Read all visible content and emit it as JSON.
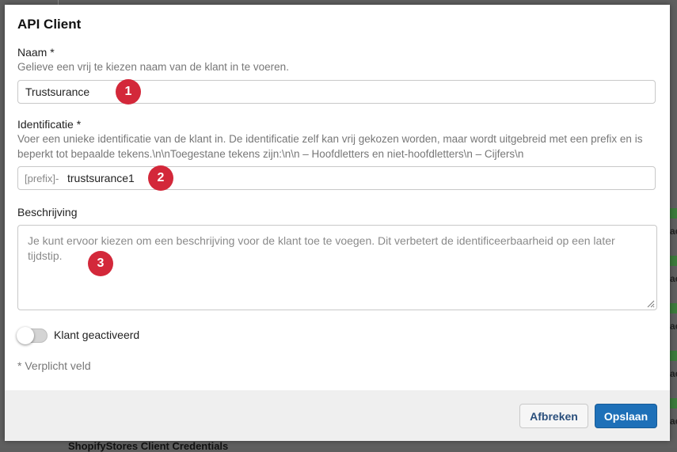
{
  "background": {
    "right_tab_text": "ac",
    "bottom_text": "ShopifyStores Client Credentials"
  },
  "modal": {
    "title": "API Client",
    "name_field": {
      "label": "Naam *",
      "help": "Gelieve een vrij te kiezen naam van de klant in te voeren.",
      "value": "Trustsurance",
      "badge": "1"
    },
    "id_field": {
      "label": "Identificatie *",
      "help": "Voer een unieke identificatie van de klant in. De identificatie zelf kan vrij gekozen worden, maar wordt uitgebreid met een prefix en is beperkt tot bepaalde tekens.\\n\\nToegestane tekens zijn:\\n\\n – Hoofdletters en niet-hoofdletters\\n – Cijfers\\n",
      "prefix": "[prefix]-",
      "value": "trustsurance1",
      "badge": "2"
    },
    "description_field": {
      "label": "Beschrijving",
      "placeholder": "Je kunt ervoor kiezen om een beschrijving voor de klant toe te voegen. Dit verbetert de identificeerbaarheid op een later tijdstip.",
      "badge": "3"
    },
    "active_toggle": {
      "label": "Klant geactiveerd",
      "on": false
    },
    "required_note": "* Verplicht veld",
    "footer": {
      "cancel_label": "Afbreken",
      "save_label": "Opslaan"
    }
  },
  "colors": {
    "badge": "#d3283a",
    "primary_button": "#1e70b8",
    "cancel_text": "#2a4f7c"
  }
}
